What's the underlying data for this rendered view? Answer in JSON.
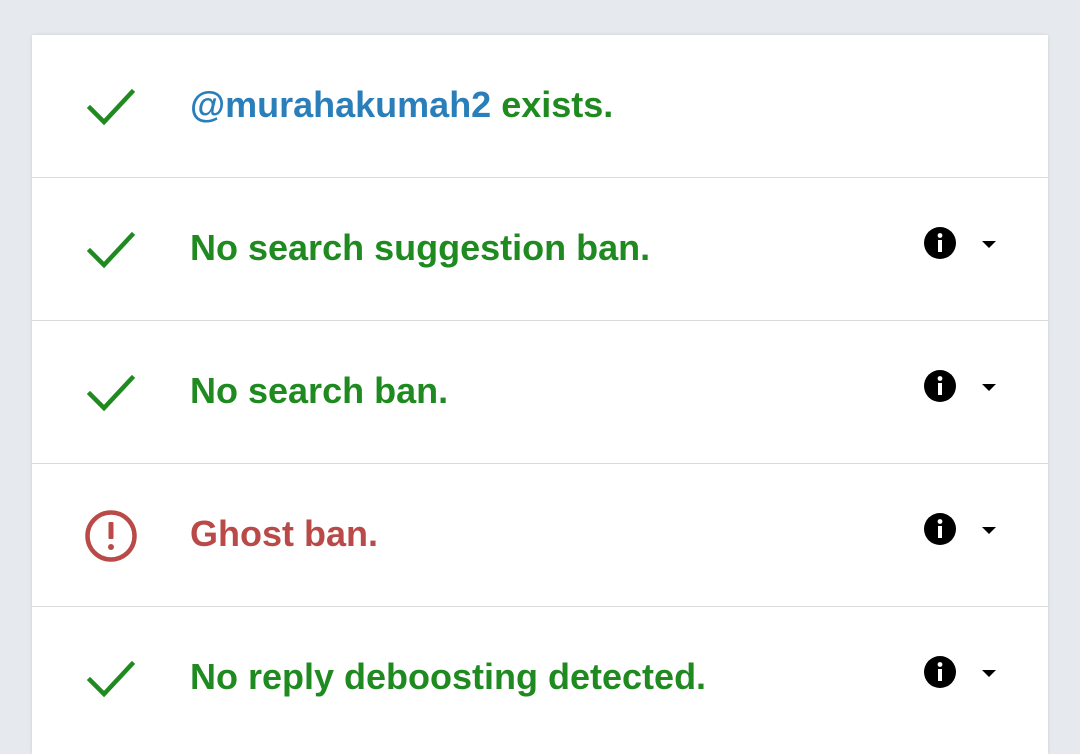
{
  "colors": {
    "ok": "#1f8a1f",
    "bad": "#b94a48",
    "handle": "#2a7fba",
    "background": "#e6eaee"
  },
  "results": [
    {
      "status": "ok",
      "icon": "check-icon",
      "handle": "@murahakumah2",
      "text": " exists.",
      "has_details": false
    },
    {
      "status": "ok",
      "icon": "check-icon",
      "text": "No search suggestion ban.",
      "has_details": true
    },
    {
      "status": "ok",
      "icon": "check-icon",
      "text": "No search ban.",
      "has_details": true
    },
    {
      "status": "bad",
      "icon": "alert-circle-icon",
      "text": "Ghost ban.",
      "has_details": true
    },
    {
      "status": "ok",
      "icon": "check-icon",
      "text": "No reply deboosting detected.",
      "has_details": true
    }
  ]
}
